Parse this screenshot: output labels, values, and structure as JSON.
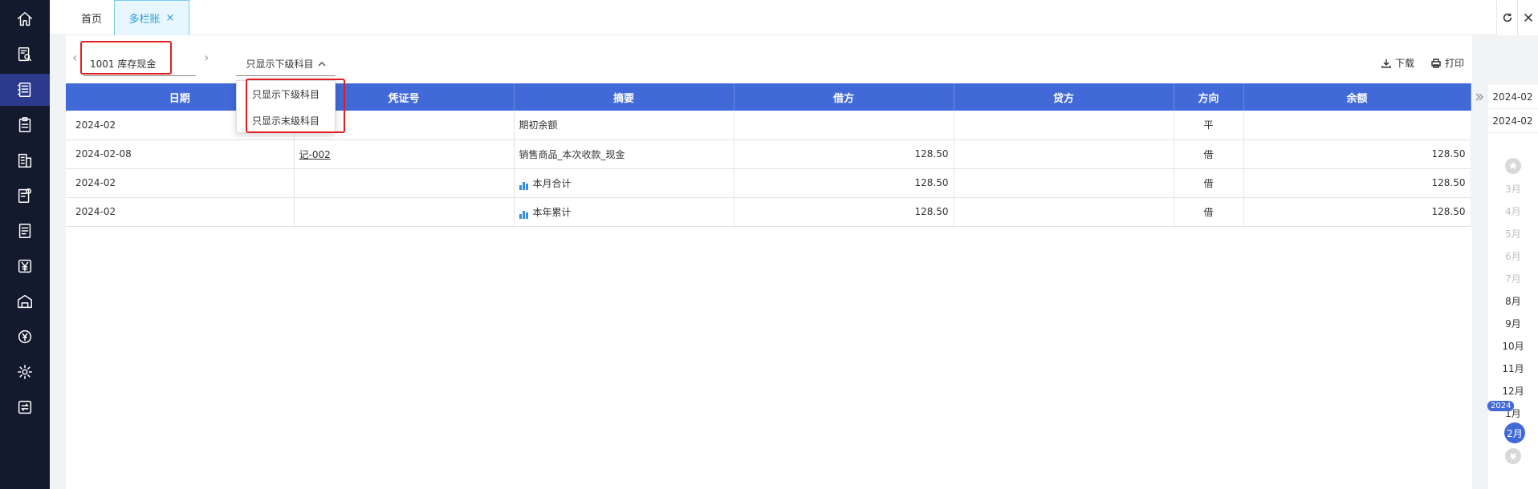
{
  "nav": {
    "items": [
      "home-icon",
      "search-doc-icon",
      "ledger-icon",
      "clipboard-icon",
      "building-icon",
      "doc-settings-icon",
      "report-icon",
      "yen-icon",
      "warehouse-icon",
      "currency-icon",
      "gear-icon",
      "exchange-icon"
    ],
    "active_index": 2
  },
  "tabs": {
    "home": "首页",
    "active": "多栏账",
    "close": "×"
  },
  "toolbar": {
    "account": "1001  库存现金",
    "filter_selected": "只显示下级科目",
    "filter_options": [
      "只显示下级科目",
      "只显示末级科目"
    ],
    "download": "下载",
    "print": "打印"
  },
  "table": {
    "headers": [
      "日期",
      "凭证号",
      "摘要",
      "借方",
      "贷方",
      "方向",
      "余额"
    ],
    "rows": [
      {
        "date": "2024-02",
        "voucher": "",
        "summary": "期初余额",
        "debit": "",
        "credit": "",
        "direction": "平",
        "balance": "",
        "chart": false
      },
      {
        "date": "2024-02-08",
        "voucher": "记-002",
        "summary": "销售商品_本次收款_现金",
        "debit": "128.50",
        "credit": "",
        "direction": "借",
        "balance": "128.50",
        "chart": false
      },
      {
        "date": "2024-02",
        "voucher": "",
        "summary": "本月合计",
        "debit": "128.50",
        "credit": "",
        "direction": "借",
        "balance": "128.50",
        "chart": true
      },
      {
        "date": "2024-02",
        "voucher": "",
        "summary": "本年累计",
        "debit": "128.50",
        "credit": "",
        "direction": "借",
        "balance": "128.50",
        "chart": true
      }
    ]
  },
  "period": {
    "start": "2024-02",
    "end": "2024-02",
    "months": [
      "3月",
      "4月",
      "5月",
      "6月",
      "7月",
      "8月",
      "9月",
      "10月",
      "11月",
      "12月",
      "1月"
    ],
    "year_badge": "2024",
    "current": "2月",
    "accent": "#4169d8"
  }
}
